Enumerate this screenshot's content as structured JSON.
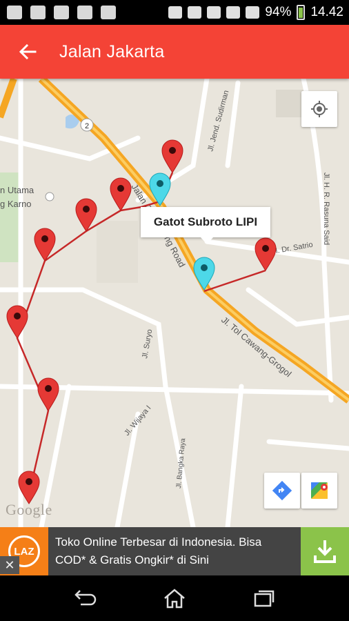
{
  "status_bar": {
    "battery": "94%",
    "time": "14.42"
  },
  "app_bar": {
    "title": "Jalan Jakarta"
  },
  "map": {
    "labels": {
      "jl_jend_sudirman": "Jl. Jend. Sudirman",
      "jl_hr_rasuna_said": "Jl. H. R. Rasuna Said",
      "jl_dr_satrio": "Jl. Dr. Satrio",
      "jl_tol_cawang": "Jl. Tol Cawang-Grogol",
      "jl_suryo": "Jl. Suryo",
      "jl_wijaya": "Jl. Wijaya I",
      "jl_bangka": "Jl. Bangka Raya",
      "gelora_1": "n Utama",
      "gelora_2": "g Karno",
      "highway_shield": "2",
      "gatot_partial": "Jalan Gatot",
      "gatot_partial_2": "ng Road"
    },
    "info_window": "Gatot Subroto LIPI",
    "google": "Google"
  },
  "ad": {
    "logo": "LAZ",
    "text_line1": "Toko Online Terbesar di Indonesia. Bisa",
    "text_line2": "COD* & Gratis Ongkir* di Sini"
  },
  "colors": {
    "accent": "#f44336",
    "marker_red": "#e53935",
    "marker_cyan": "#4dd8e8",
    "route": "#c62828",
    "highway": "#f5a623",
    "ad_green": "#8bc34a",
    "ad_orange": "#f57f17"
  }
}
